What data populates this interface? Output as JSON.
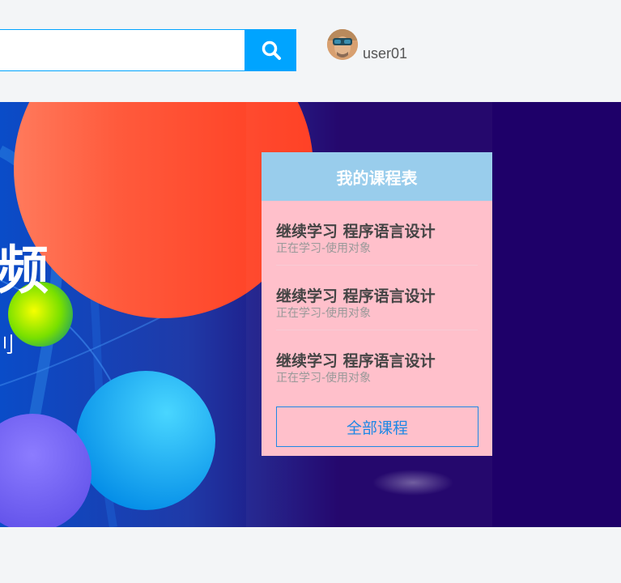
{
  "header": {
    "search": {
      "value": "",
      "placeholder": ""
    },
    "user": {
      "name": "user01"
    }
  },
  "banner": {
    "headline": "频",
    "subline": "刂"
  },
  "course_panel": {
    "title": "我的课程表",
    "items": [
      {
        "title": "继续学习 程序语言设计",
        "status": "正在学习-使用对象"
      },
      {
        "title": "继续学习 程序语言设计",
        "status": "正在学习-使用对象"
      },
      {
        "title": "继续学习 程序语言设计",
        "status": "正在学习-使用对象"
      }
    ],
    "all_courses_label": "全部课程"
  },
  "colors": {
    "accent": "#00a4ff",
    "panel_bg": "#ffc0cb",
    "panel_head": "#99cdec",
    "banner_bg": "#1e0069",
    "link_blue": "#1e88e5"
  },
  "icons": {
    "search": "search-icon",
    "avatar": "avatar"
  }
}
